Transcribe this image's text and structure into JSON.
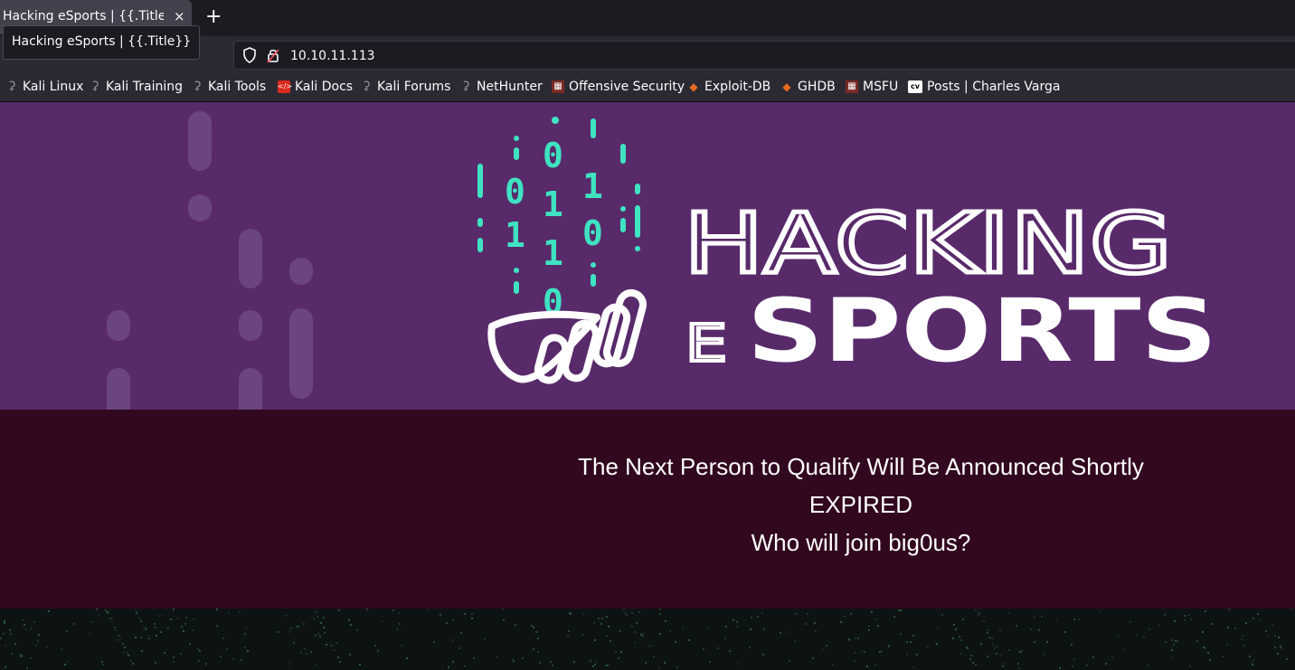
{
  "browser": {
    "tab_title": "Hacking eSports | {{.Title}}",
    "tab_close": "×",
    "new_tab": "+",
    "tooltip": "Hacking eSports | {{.Title}}",
    "url": "10.10.11.113",
    "nav": {
      "back": "←",
      "forward": "→",
      "reload": "↻",
      "home": "⌂"
    }
  },
  "bookmarks": [
    {
      "label": "Kali Linux",
      "icon": "kali-dragon-icon"
    },
    {
      "label": "Kali Training",
      "icon": "kali-dragon-icon"
    },
    {
      "label": "Kali Tools",
      "icon": "kali-dragon-icon"
    },
    {
      "label": "Kali Docs",
      "icon": "kali-docs-icon"
    },
    {
      "label": "Kali Forums",
      "icon": "kali-dragon-icon"
    },
    {
      "label": "NetHunter",
      "icon": "kali-dragon-icon"
    },
    {
      "label": "Offensive Security",
      "icon": "offsec-icon"
    },
    {
      "label": "Exploit-DB",
      "icon": "exploit-db-icon"
    },
    {
      "label": "GHDB",
      "icon": "exploit-db-icon"
    },
    {
      "label": "MSFU",
      "icon": "offsec-icon"
    },
    {
      "label": "Posts | Charles Varga",
      "icon": "cv-icon"
    }
  ],
  "logo": {
    "word1": "HACKING",
    "word2_small": "E",
    "word2_big": "SPORTS",
    "binary_columns": [
      {
        "digits": [
          "1"
        ]
      },
      {
        "digits": [
          "0",
          "1"
        ]
      },
      {
        "digits": [
          "0",
          "1",
          "1",
          "0"
        ]
      },
      {
        "digits": [
          "1",
          "0"
        ]
      },
      {
        "digits": [
          "1"
        ]
      }
    ]
  },
  "announcement": {
    "line1": "The Next Person to Qualify Will Be Announced Shortly",
    "line2": "EXPIRED",
    "line3": "Who will join big0us?"
  },
  "colors": {
    "hero_bg": "#582a6a",
    "announce_bg": "#31081f",
    "binary_accent": "#3fe3c2",
    "footer_bg": "#0d1313"
  }
}
